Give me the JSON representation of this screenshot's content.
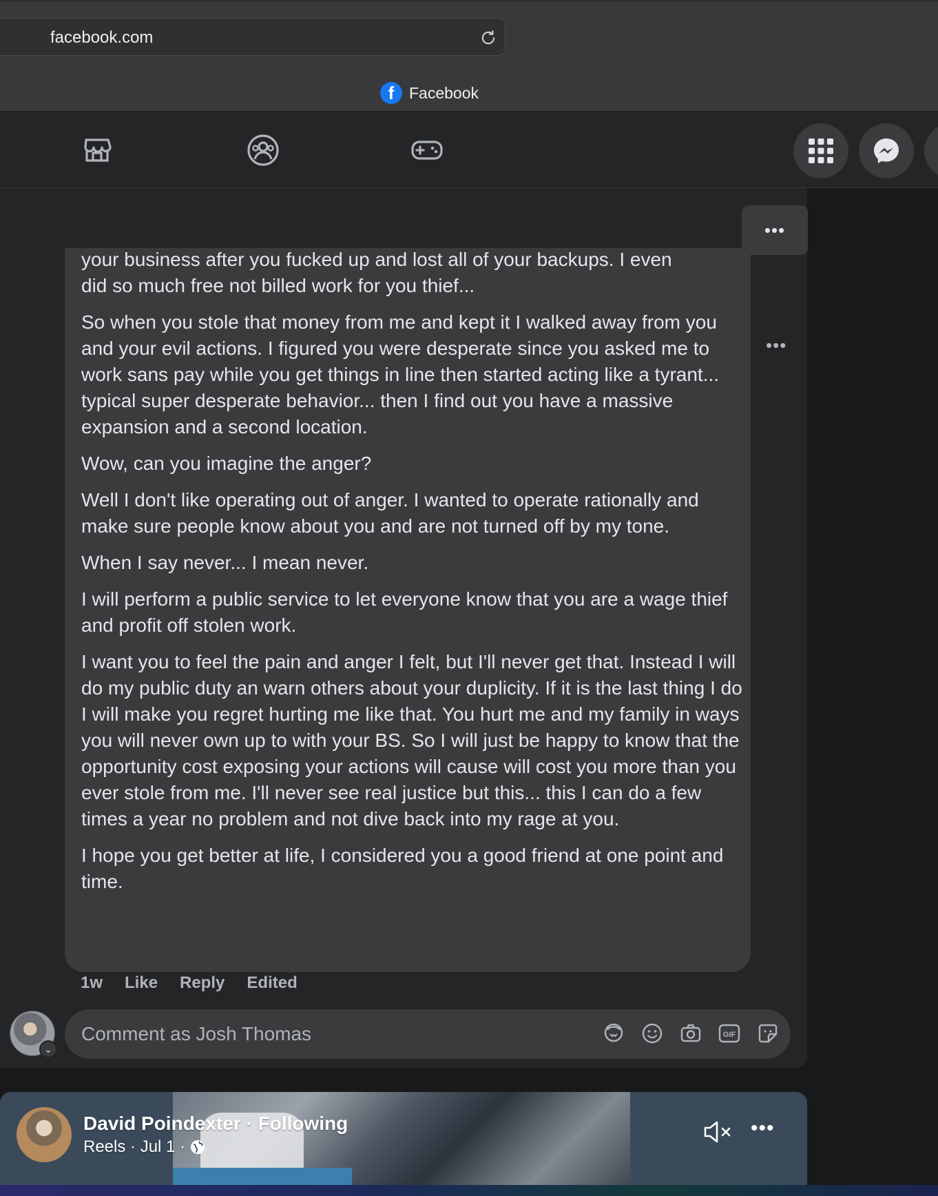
{
  "browser": {
    "url": "facebook.com",
    "tab_title": "Facebook"
  },
  "header": {
    "nav_icons": [
      "marketplace-icon",
      "groups-icon",
      "gaming-icon"
    ],
    "right_buttons": [
      "menu-grid-icon",
      "messenger-icon"
    ]
  },
  "post": {
    "more_label": "•••",
    "comment": {
      "clipped_line": "your business after you fucked up and lost all of your backups. I even",
      "paragraphs": [
        "did so much free not billed work for you thief...",
        "So when you stole that money from me and kept it I walked away from you and your evil actions. I figured you were desperate since you asked me to work sans pay while you get things in line then started acting like a tyrant... typical super desperate behavior... then I find out you have a massive expansion and a second location.",
        "Wow, can you imagine the anger?",
        "Well I don't like operating out of anger. I wanted to operate rationally and make sure people know about you and are not turned off by my tone.",
        "When I say never... I mean never.",
        "I will perform a public service to let everyone know that you are a wage thief and profit off stolen work.",
        "I want you to feel the pain and anger I felt, but I'll never get that. Instead I will do my public duty an warn others about your duplicity. If it is the last thing I do I will make you regret hurting me like that. You hurt me and my family in ways you will never own up to with your BS. So I will just be happy to know that the opportunity cost exposing your actions will cause will cost you more than you ever stole from me. I'll never see real justice but this... this I can do a few times a year no problem and not dive back into my rage at you.",
        "I hope you get better at life, I considered you a good friend at one point and time."
      ],
      "side_more": "•••",
      "time": "1w",
      "like": "Like",
      "reply": "Reply",
      "edited": "Edited"
    },
    "composer": {
      "placeholder": "Comment as Josh Thomas",
      "tools": [
        "avatar-sticker-icon",
        "emoji-icon",
        "camera-icon",
        "gif-icon",
        "sticker-icon"
      ]
    }
  },
  "reel": {
    "author": "David Poindexter · Following",
    "meta": "Reels · Jul 1 ·",
    "more": "•••"
  },
  "colors": {
    "page_bg": "#18191a",
    "card_bg": "#242526",
    "bubble_bg": "#3a3b3c",
    "text_primary": "#e4e6eb",
    "text_secondary": "#b0b3b8",
    "facebook_blue": "#1877f2"
  }
}
